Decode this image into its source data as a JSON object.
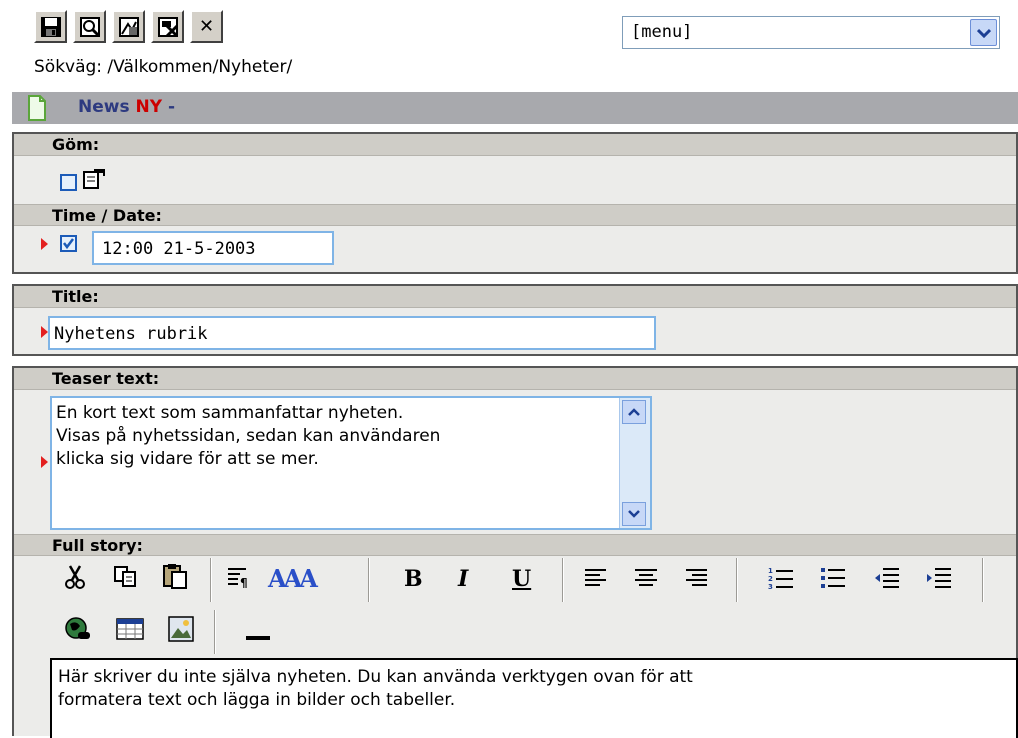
{
  "toolbar": {
    "buttons": [
      {
        "name": "save-icon"
      },
      {
        "name": "preview-icon"
      },
      {
        "name": "save-publish-icon"
      },
      {
        "name": "save-close-icon"
      },
      {
        "name": "close-icon",
        "glyph": "✕"
      }
    ]
  },
  "menu_select": {
    "value": "[menu]"
  },
  "path_text": "Sökväg: /Välkommen/Nyheter/",
  "doc_header": {
    "title": "News",
    "status": "NY",
    "suffix": " -"
  },
  "fields": {
    "hide_label": "Göm:",
    "time_label": "Time / Date:",
    "time_value": "12:00 21-5-2003",
    "title_label": "Title:",
    "title_value": "Nyhetens rubrik",
    "teaser_label": "Teaser text:",
    "teaser_value": "En kort text som sammanfattar nyheten.\nVisas på nyhetssidan, sedan kan användaren\nklicka sig vidare för att se mer.",
    "full_story_label": "Full story:",
    "full_story_value": "Här skriver du inte själva nyheten. Du kan använda verktygen ovan för att\nformatera text och lägga in bilder och tabeller."
  },
  "editor_tools": {
    "bold": "B",
    "italic": "I",
    "underline": "U",
    "font_glyph": "AAA"
  },
  "colors": {
    "header_bar": "#a8a9ad",
    "section_header": "#cfcdc7",
    "panel_bg": "#ececea",
    "status_red": "#cc0000",
    "title_blue": "#2d3a80",
    "input_border": "#7fb4e6"
  }
}
